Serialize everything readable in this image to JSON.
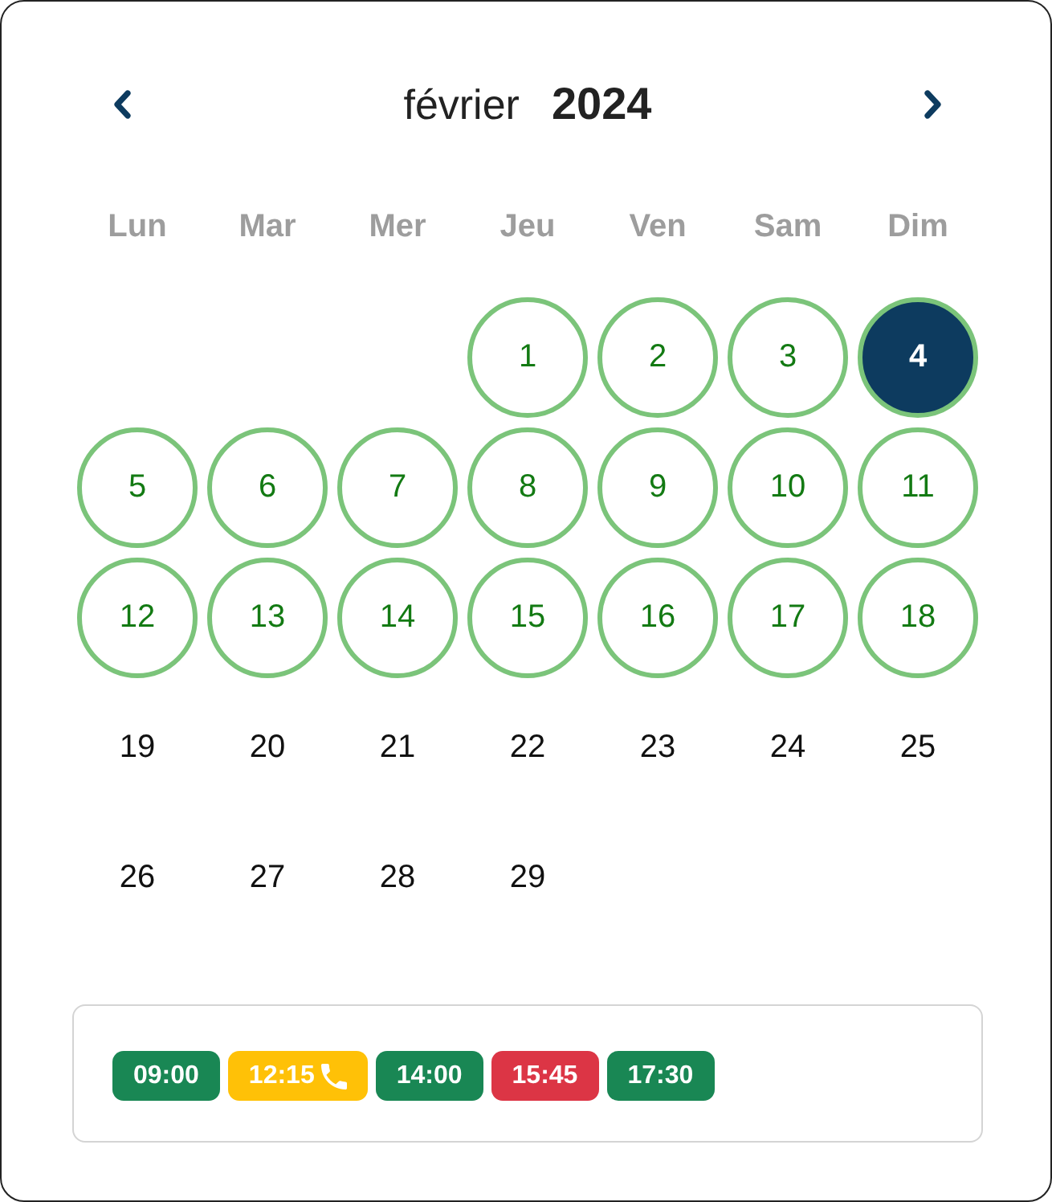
{
  "header": {
    "month": "février",
    "year": "2024"
  },
  "weekdays": [
    "Lun",
    "Mar",
    "Mer",
    "Jeu",
    "Ven",
    "Sam",
    "Dim"
  ],
  "weeks": [
    {
      "kind": "first",
      "days": [
        {
          "label": "1",
          "available": true,
          "selected": false
        },
        {
          "label": "2",
          "available": true,
          "selected": false
        },
        {
          "label": "3",
          "available": true,
          "selected": false
        },
        {
          "label": "4",
          "available": true,
          "selected": true
        }
      ]
    },
    {
      "kind": "full",
      "days": [
        {
          "label": "5",
          "available": true,
          "selected": false
        },
        {
          "label": "6",
          "available": true,
          "selected": false
        },
        {
          "label": "7",
          "available": true,
          "selected": false
        },
        {
          "label": "8",
          "available": true,
          "selected": false
        },
        {
          "label": "9",
          "available": true,
          "selected": false
        },
        {
          "label": "10",
          "available": true,
          "selected": false
        },
        {
          "label": "11",
          "available": true,
          "selected": false
        }
      ]
    },
    {
      "kind": "full",
      "days": [
        {
          "label": "12",
          "available": true,
          "selected": false
        },
        {
          "label": "13",
          "available": true,
          "selected": false
        },
        {
          "label": "14",
          "available": true,
          "selected": false
        },
        {
          "label": "15",
          "available": true,
          "selected": false
        },
        {
          "label": "16",
          "available": true,
          "selected": false
        },
        {
          "label": "17",
          "available": true,
          "selected": false
        },
        {
          "label": "18",
          "available": true,
          "selected": false
        }
      ]
    },
    {
      "kind": "full",
      "days": [
        {
          "label": "19",
          "available": false,
          "selected": false
        },
        {
          "label": "20",
          "available": false,
          "selected": false
        },
        {
          "label": "21",
          "available": false,
          "selected": false
        },
        {
          "label": "22",
          "available": false,
          "selected": false
        },
        {
          "label": "23",
          "available": false,
          "selected": false
        },
        {
          "label": "24",
          "available": false,
          "selected": false
        },
        {
          "label": "25",
          "available": false,
          "selected": false
        }
      ]
    },
    {
      "kind": "last",
      "days": [
        {
          "label": "26",
          "available": false,
          "selected": false
        },
        {
          "label": "27",
          "available": false,
          "selected": false
        },
        {
          "label": "28",
          "available": false,
          "selected": false
        },
        {
          "label": "29",
          "available": false,
          "selected": false
        }
      ]
    }
  ],
  "time_slots": [
    {
      "time": "09:00",
      "color": "#198754",
      "phone": false
    },
    {
      "time": "12:15",
      "color": "#ffc107",
      "phone": true
    },
    {
      "time": "14:00",
      "color": "#198754",
      "phone": false
    },
    {
      "time": "15:45",
      "color": "#dc3545",
      "phone": false
    },
    {
      "time": "17:30",
      "color": "#198754",
      "phone": false
    }
  ]
}
